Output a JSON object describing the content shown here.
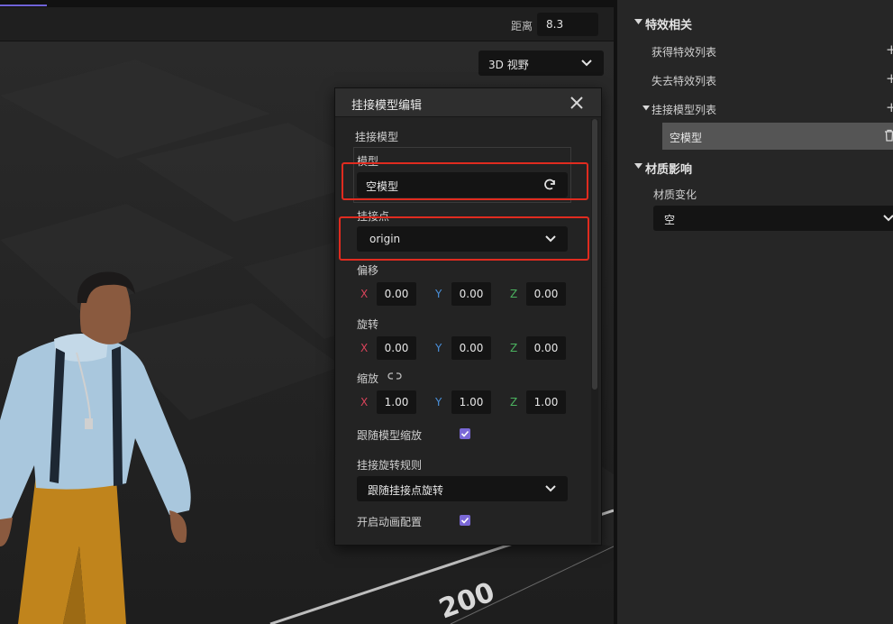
{
  "viewport": {
    "distance_label": "距离",
    "distance_value": "8.3",
    "view_mode": "3D 视野",
    "ground_label": "200"
  },
  "dialog": {
    "title": "挂接模型编辑",
    "section_label": "挂接模型",
    "model_label": "模型",
    "model_value": "空模型",
    "attach_point_label": "挂接点",
    "attach_point_value": "origin",
    "offset_label": "偏移",
    "rotation_label": "旋转",
    "scale_label": "缩放",
    "axis_x": "X",
    "axis_y": "Y",
    "axis_z": "Z",
    "offset": {
      "x": "0.00",
      "y": "0.00",
      "z": "0.00"
    },
    "rotation": {
      "x": "0.00",
      "y": "0.00",
      "z": "0.00"
    },
    "scale": {
      "x": "1.00",
      "y": "1.00",
      "z": "1.00"
    },
    "follow_scale_label": "跟随模型缩放",
    "follow_scale_checked": true,
    "rotate_rule_label": "挂接旋转规则",
    "rotate_rule_value": "跟随挂接点旋转",
    "enable_anim_label": "开启动画配置",
    "enable_anim_checked": true
  },
  "right_panel": {
    "effects_header": "特效相关",
    "gain_effects": "获得特效列表",
    "lose_effects": "失去特效列表",
    "attach_model_list": "挂接模型列表",
    "attach_model_item": "空模型",
    "material_header": "材质影响",
    "material_change_label": "材质变化",
    "material_change_value": "空"
  },
  "colors": {
    "accent": "#7a68d6",
    "highlight_box": "#e02b1f",
    "axis_x": "#d8435a",
    "axis_y": "#4a8fd9",
    "axis_z": "#4bb25f"
  }
}
